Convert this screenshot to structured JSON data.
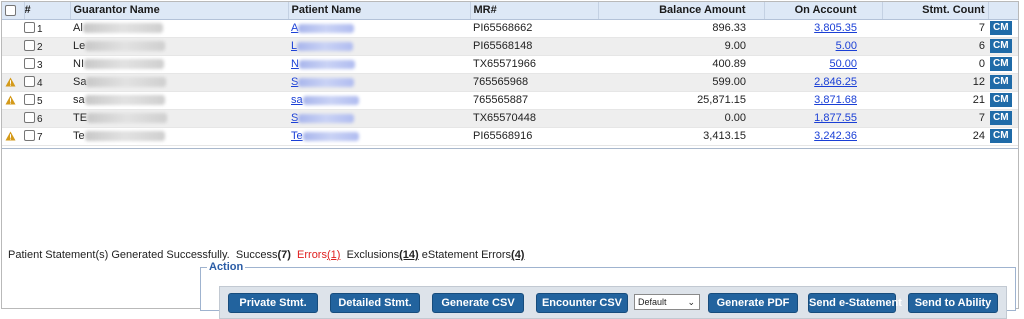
{
  "grid": {
    "columns": {
      "select": "",
      "index": "#",
      "guarantor": "Guarantor Name",
      "patient": "Patient Name",
      "mr": "MR#",
      "balance": "Balance Amount",
      "on_account": "On Account",
      "stmt_count": "Stmt. Count"
    },
    "rows": [
      {
        "index": "1",
        "guarantor": "Al",
        "patient": "A",
        "mr": "PI65568662",
        "balance": "896.33",
        "on_account": "3,805.35",
        "stmt_count": "7",
        "action": "CM",
        "warning": false
      },
      {
        "index": "2",
        "guarantor": "Le",
        "patient": "L",
        "mr": "PI65568148",
        "balance": "9.00",
        "on_account": "5.00",
        "stmt_count": "6",
        "action": "CM",
        "warning": false
      },
      {
        "index": "3",
        "guarantor": "NI",
        "patient": "N",
        "mr": "TX65571966",
        "balance": "400.89",
        "on_account": "50.00",
        "stmt_count": "0",
        "action": "CM",
        "warning": false
      },
      {
        "index": "4",
        "guarantor": "Sa",
        "patient": "S",
        "mr": "765565968",
        "balance": "599.00",
        "on_account": "2,846.25",
        "stmt_count": "12",
        "action": "CM",
        "warning": true
      },
      {
        "index": "5",
        "guarantor": "sa",
        "patient": "sa",
        "mr": "765565887",
        "balance": "25,871.15",
        "on_account": "3,871.68",
        "stmt_count": "21",
        "action": "CM",
        "warning": true
      },
      {
        "index": "6",
        "guarantor": "TE",
        "patient": "S",
        "mr": "TX65570448",
        "balance": "0.00",
        "on_account": "1,877.55",
        "stmt_count": "7",
        "action": "CM",
        "warning": false
      },
      {
        "index": "7",
        "guarantor": "Te",
        "patient": "Te",
        "mr": "PI65568916",
        "balance": "3,413.15",
        "on_account": "3,242.36",
        "stmt_count": "24",
        "action": "CM",
        "warning": true
      }
    ]
  },
  "status": {
    "message": "Patient Statement(s) Generated Successfully.",
    "success_label": "Success",
    "success_count": "(7)",
    "errors_label": "Errors",
    "errors_count": "(1)",
    "exclusions_label": "Exclusions",
    "exclusions_count": "(14)",
    "estatement_label": "eStatement Errors",
    "estatement_count": "(4)"
  },
  "action": {
    "legend": "Action",
    "private_stmt": "Private Stmt.",
    "detailed_stmt": "Detailed Stmt.",
    "generate_csv": "Generate CSV",
    "encounter_csv": "Encounter CSV",
    "template_select": "Default",
    "generate_pdf": "Generate PDF",
    "send_estatement": "Send e-Statement",
    "send_ability": "Send to Ability"
  },
  "colors": {
    "header_bg": "#dde8f6",
    "button_blue": "#22639e",
    "link_blue": "#1a3fd6",
    "error_red": "#e02020",
    "warning_amber": "#d49a1a"
  },
  "icons": {
    "warning": "warning-icon",
    "checkbox": "checkbox",
    "dropdown": "chevron-down-icon"
  }
}
